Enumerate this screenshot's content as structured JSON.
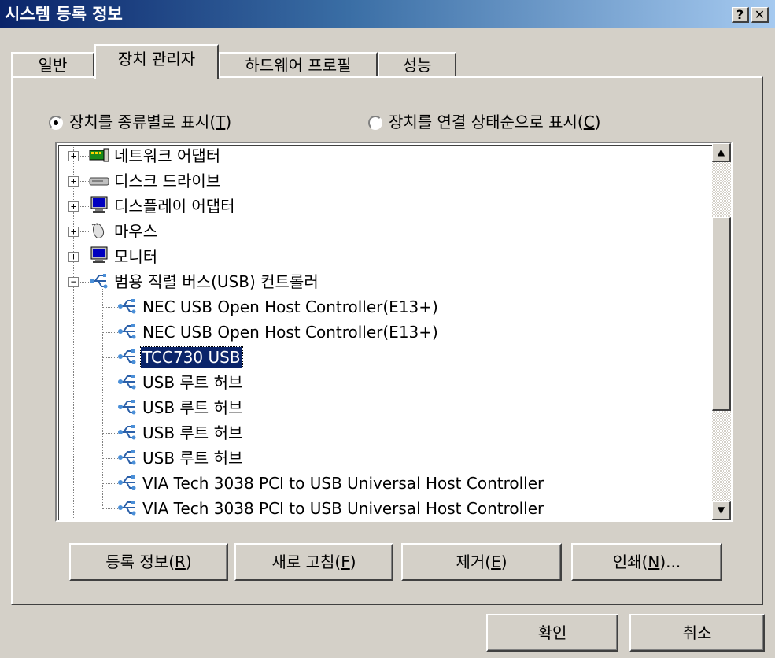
{
  "window": {
    "title": "시스템 등록 정보",
    "help_button": "?",
    "close_button": "✕"
  },
  "tabs": [
    {
      "label": "일반",
      "active": false
    },
    {
      "label": "장치 관리자",
      "active": true
    },
    {
      "label": "하드웨어 프로필",
      "active": false
    },
    {
      "label": "성능",
      "active": false
    }
  ],
  "view_options": {
    "by_type": {
      "label": "장치를 종류별로 표시(",
      "key": "T",
      "suffix": ")",
      "checked": true
    },
    "by_connection": {
      "label": "장치를 연결 상태순으로 표시(",
      "key": "C",
      "suffix": ")",
      "checked": false
    }
  },
  "tree": {
    "categories": [
      {
        "label": "네트워크 어댑터",
        "icon": "network-adapter-icon",
        "expanded": false
      },
      {
        "label": "디스크 드라이브",
        "icon": "disk-drive-icon",
        "expanded": false
      },
      {
        "label": "디스플레이 어댑터",
        "icon": "display-adapter-icon",
        "expanded": false
      },
      {
        "label": "마우스",
        "icon": "mouse-icon",
        "expanded": false
      },
      {
        "label": "모니터",
        "icon": "monitor-icon",
        "expanded": false
      },
      {
        "label": "범용 직렬 버스(USB) 컨트롤러",
        "icon": "usb-icon",
        "expanded": true
      }
    ],
    "usb_devices": [
      {
        "label": "NEC USB Open Host Controller(E13+)",
        "selected": false
      },
      {
        "label": "NEC USB Open Host Controller(E13+)",
        "selected": false
      },
      {
        "label": "TCC730 USB",
        "selected": true
      },
      {
        "label": "USB 루트 허브",
        "selected": false
      },
      {
        "label": "USB 루트 허브",
        "selected": false
      },
      {
        "label": "USB 루트 허브",
        "selected": false
      },
      {
        "label": "USB 루트 허브",
        "selected": false
      },
      {
        "label": "VIA Tech 3038 PCI to USB Universal Host Controller",
        "selected": false
      },
      {
        "label": "VIA Tech 3038 PCI to USB Universal Host Controller",
        "selected": false
      }
    ]
  },
  "buttons": {
    "properties": {
      "label": "등록 정보(",
      "key": "R",
      "suffix": ")"
    },
    "refresh": {
      "label": "새로 고침(",
      "key": "F",
      "suffix": ")"
    },
    "remove": {
      "label": "제거(",
      "key": "E",
      "suffix": ")"
    },
    "print": {
      "label": "인쇄(",
      "key": "N",
      "suffix": ")..."
    },
    "ok": "확인",
    "cancel": "취소"
  },
  "colors": {
    "face": "#d4d0c8",
    "title_start": "#0a246a",
    "title_end": "#a6caf0",
    "selection": "#0a246a",
    "usb_icon": "#4a8fd8"
  }
}
